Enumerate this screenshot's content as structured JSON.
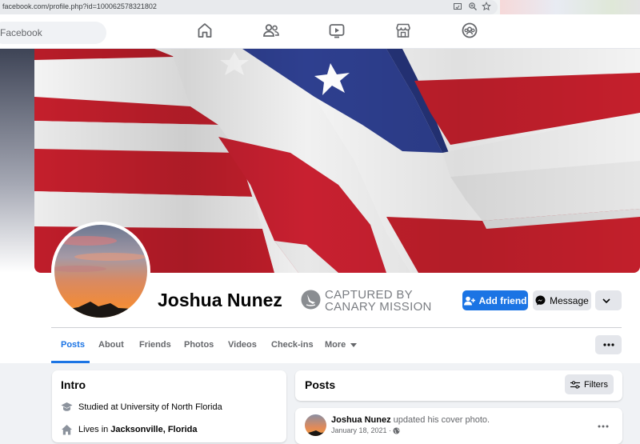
{
  "browser": {
    "url": "facebook.com/profile.php?id=100062578321802"
  },
  "nav": {
    "search_placeholder": "Facebook",
    "tabs": [
      "home-icon",
      "friends-icon",
      "watch-icon",
      "marketplace-icon",
      "groups-icon"
    ]
  },
  "profile": {
    "name": "Joshua Nunez",
    "badge_line1": "CAPTURED BY",
    "badge_line2": "CANARY MISSION",
    "add_friend_label": "Add friend",
    "message_label": "Message"
  },
  "tabs": [
    "Posts",
    "About",
    "Friends",
    "Photos",
    "Videos",
    "Check-ins",
    "More"
  ],
  "intro": {
    "title": "Intro",
    "studied_prefix": "Studied at ",
    "studied_school": "University of North Florida",
    "lives_prefix": "Lives in ",
    "lives_city": "Jacksonville, Florida"
  },
  "posts": {
    "title": "Posts",
    "filters_label": "Filters",
    "first_post": {
      "author": "Joshua Nunez",
      "action": " updated his cover photo.",
      "date": "January 18, 2021 ·"
    }
  },
  "colors": {
    "accent": "#1b74e4",
    "flag_red": "#c21f2b",
    "flag_blue": "#2e3f8f"
  }
}
